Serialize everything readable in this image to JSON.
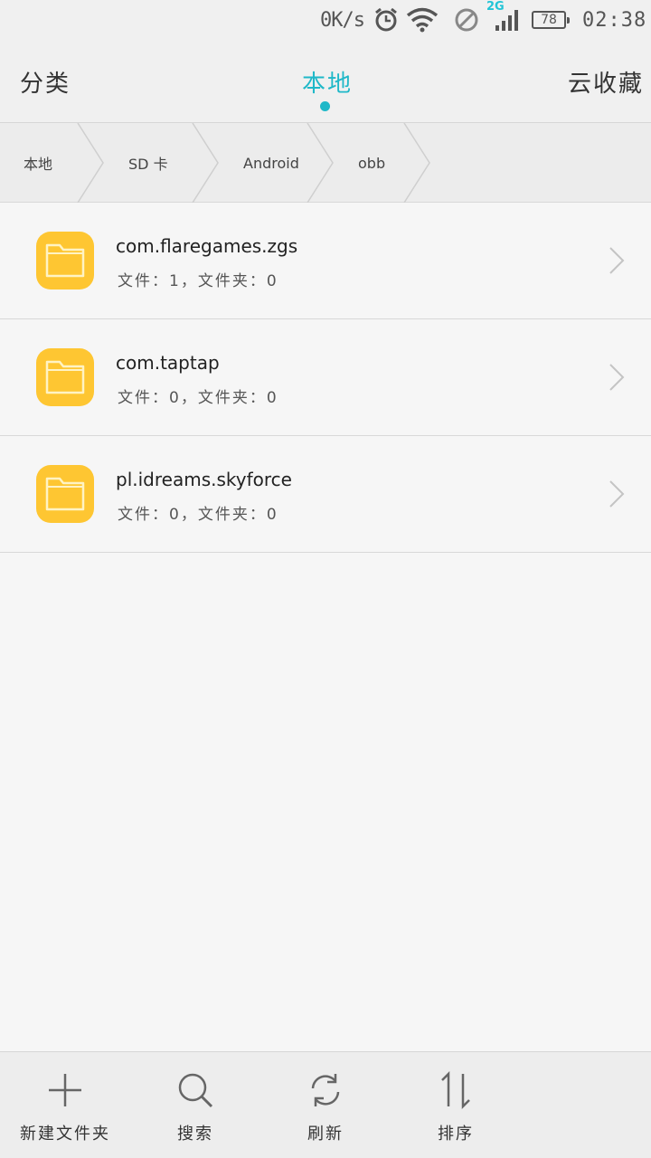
{
  "status_bar": {
    "net_speed": "0K/s",
    "network_type": "2G",
    "battery": "78",
    "time": "02:38"
  },
  "tabs": {
    "left": "分类",
    "center": "本地",
    "right": "云收藏",
    "active": "center",
    "accent_color": "#1fb8c8"
  },
  "breadcrumb": {
    "items": [
      "本地",
      "SD 卡",
      "Android",
      "obb"
    ]
  },
  "files": [
    {
      "name": "com.flaregames.zgs",
      "meta": "文件：1，文件夹：0"
    },
    {
      "name": "com.taptap",
      "meta": "文件：0，文件夹：0"
    },
    {
      "name": "pl.idreams.skyforce",
      "meta": "文件：0，文件夹：0"
    }
  ],
  "folder_color": "#fec632",
  "toolbar": {
    "new_folder": "新建文件夹",
    "search": "搜索",
    "refresh": "刷新",
    "sort": "排序"
  }
}
